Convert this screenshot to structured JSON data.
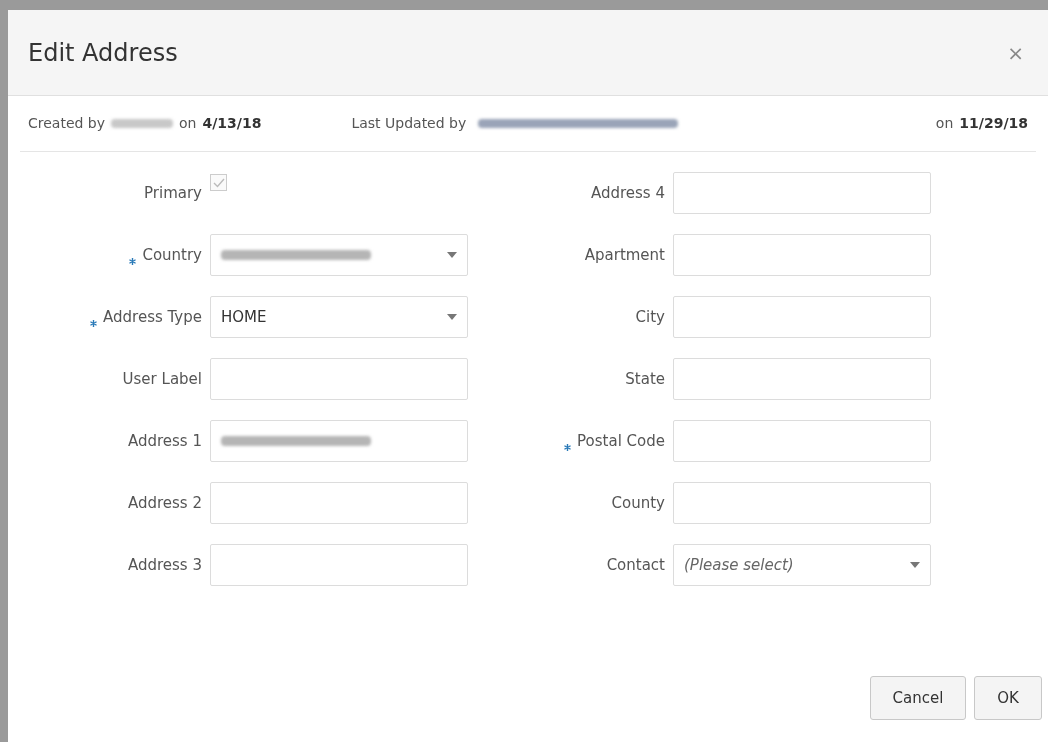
{
  "dialog": {
    "title": "Edit Address",
    "close": "×"
  },
  "audit": {
    "created_prefix": "Created by",
    "created_by_redacted": true,
    "created_on_prefix": "on",
    "created_date": "4/13/18",
    "updated_prefix": "Last Updated by",
    "updated_by_redacted": true,
    "updated_on_prefix": "on",
    "updated_date": "11/29/18"
  },
  "left_fields": [
    {
      "kind": "checkbox",
      "label": "Primary",
      "required": false,
      "checked": true,
      "disabled": true
    },
    {
      "kind": "select",
      "label": "Country",
      "required": true,
      "value_redacted": true
    },
    {
      "kind": "select",
      "label": "Address Type",
      "required": true,
      "value": "HOME"
    },
    {
      "kind": "text",
      "label": "User Label",
      "required": false
    },
    {
      "kind": "text",
      "label": "Address 1",
      "required": false,
      "value_redacted": true
    },
    {
      "kind": "text",
      "label": "Address 2",
      "required": false
    },
    {
      "kind": "text",
      "label": "Address 3",
      "required": false
    }
  ],
  "right_fields": [
    {
      "kind": "text",
      "label": "Address 4",
      "required": false
    },
    {
      "kind": "text",
      "label": "Apartment",
      "required": false
    },
    {
      "kind": "text",
      "label": "City",
      "required": false
    },
    {
      "kind": "text",
      "label": "State",
      "required": false
    },
    {
      "kind": "text",
      "label": "Postal Code",
      "required": true
    },
    {
      "kind": "text",
      "label": "County",
      "required": false
    },
    {
      "kind": "select",
      "label": "Contact",
      "required": false,
      "placeholder": "(Please select)"
    }
  ],
  "buttons": [
    "Cancel",
    "OK"
  ]
}
